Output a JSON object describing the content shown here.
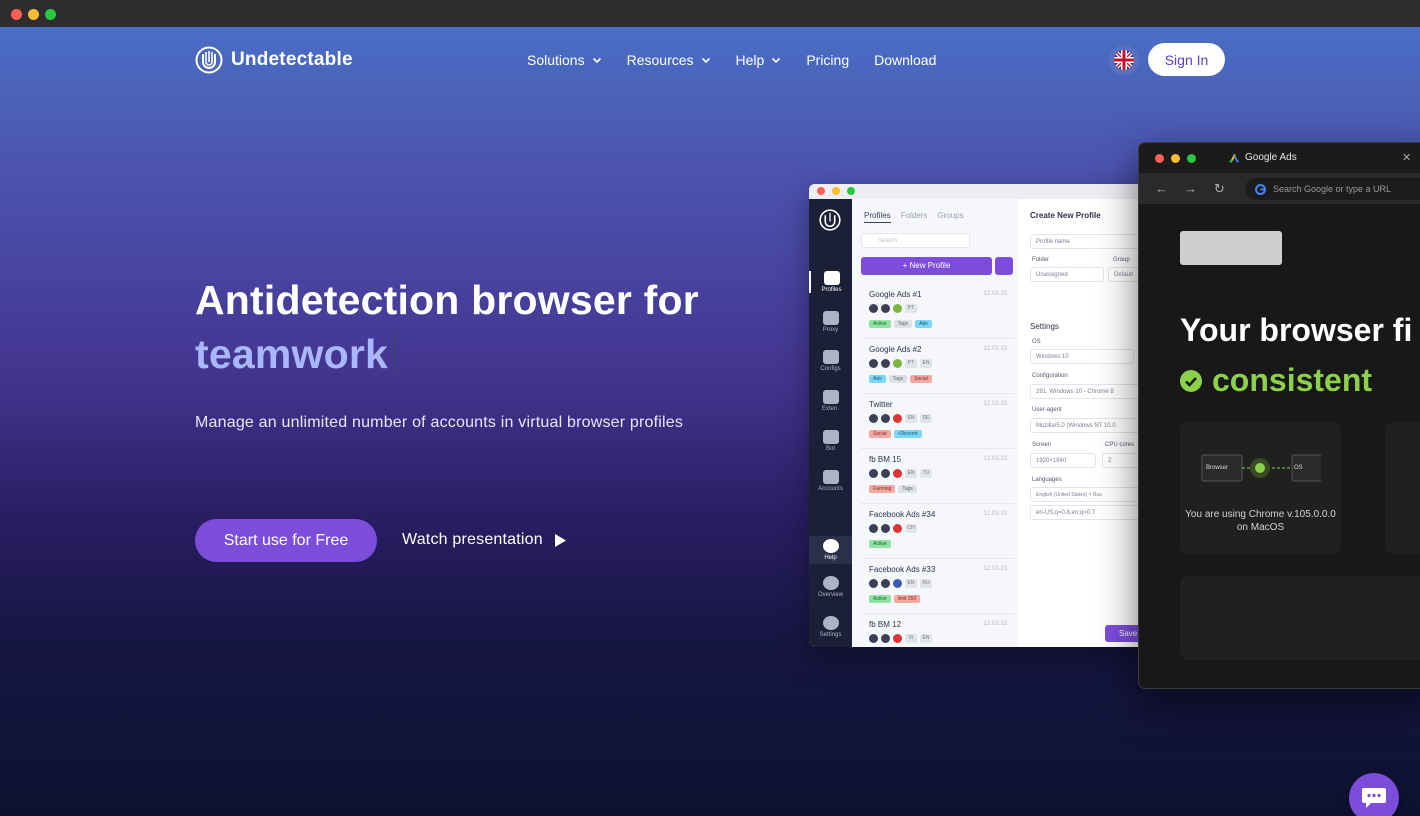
{
  "brand": {
    "name": "Undetectable"
  },
  "nav": {
    "solutions": "Solutions",
    "resources": "Resources",
    "help": "Help",
    "pricing": "Pricing",
    "download": "Download"
  },
  "header": {
    "signin_label": "Sign In",
    "language_flag": "uk-flag-icon"
  },
  "hero": {
    "headline_line1": "Antidetection browser for",
    "headline_accent": "teamwork",
    "subtext": "Manage an unlimited number of accounts in virtual browser profiles",
    "cta_label": "Start use for Free",
    "watch_label": "Watch presentation"
  },
  "app": {
    "sidebar": [
      "Profiles",
      "Proxy",
      "Configs",
      "Exten.",
      "Bot",
      "Accounts",
      "Help",
      "Overview",
      "Settings"
    ],
    "tabs": [
      "Profiles",
      "Folders",
      "Groups"
    ],
    "search_placeholder": "Search",
    "new_profile_label": "+ New Profile",
    "profiles": [
      {
        "name": "Google Ads #1",
        "date": "12.03.23",
        "chips": [
          "PT"
        ],
        "tags": [
          "Active",
          "Tags",
          "Ads"
        ]
      },
      {
        "name": "Google Ads #2",
        "date": "12.03.23",
        "chips": [
          "PT",
          "EN"
        ],
        "tags": [
          "Ads",
          "Tags",
          "Social"
        ]
      },
      {
        "name": "Twitter",
        "date": "12.03.23",
        "chips": [
          "EN",
          "DE"
        ],
        "tags": [
          "Social",
          "+Discord"
        ]
      },
      {
        "name": "fb BM 15",
        "date": "12.03.23",
        "chips": [
          "EN",
          "TU"
        ],
        "tags": [
          "Farming",
          "Tags"
        ]
      },
      {
        "name": "Facebook Ads #34",
        "date": "12.03.23",
        "chips": [
          "CH"
        ],
        "tags": [
          "Active"
        ]
      },
      {
        "name": "Facebook Ads #33",
        "date": "12.03.23",
        "chips": [
          "EN",
          "RU"
        ],
        "tags": [
          "Active",
          "limit 250"
        ]
      },
      {
        "name": "fb BM 12",
        "date": "12.03.23",
        "chips": [
          "VI",
          "EN"
        ],
        "tags": []
      }
    ],
    "form": {
      "title": "Create New Profile",
      "profile_name_placeholder": "Profile name",
      "folder_label": "Folder",
      "folder_value": "Unassigned",
      "group_label": "Group",
      "group_value": "Default",
      "settings_label": "Settings",
      "os_label": "OS",
      "os_value": "Windows 10",
      "configuration_label": "Configuration",
      "configuration_value": "291: Windows 10 - Chrome 8",
      "useragent_label": "User-agent",
      "useragent_value": "Mozilla/5.0 (Windows NT 10.0",
      "screen_label": "Screen",
      "screen_value": "1920×1840",
      "cpu_label": "CPU cores",
      "cpu_value": "2",
      "languages_label": "Languages",
      "language_chip_1": "English (United States)",
      "language_chip_2": "Rus",
      "accept_language": "en-US;q=0.8,en;q=0.7",
      "save_label": "Save"
    }
  },
  "browser": {
    "tab_title": "Google Ads",
    "url_placeholder": "Search Google or type a URL",
    "heading": "Your browser fi",
    "status": "consistent",
    "card_labels": [
      "Browser",
      "OS"
    ],
    "card_text": "You are using Chrome v.105.0.0.0 on MacOS"
  },
  "colors": {
    "accent": "#7c4ddb",
    "accent_text": "#a9b7ff",
    "consistent_green": "#8dd14b"
  }
}
